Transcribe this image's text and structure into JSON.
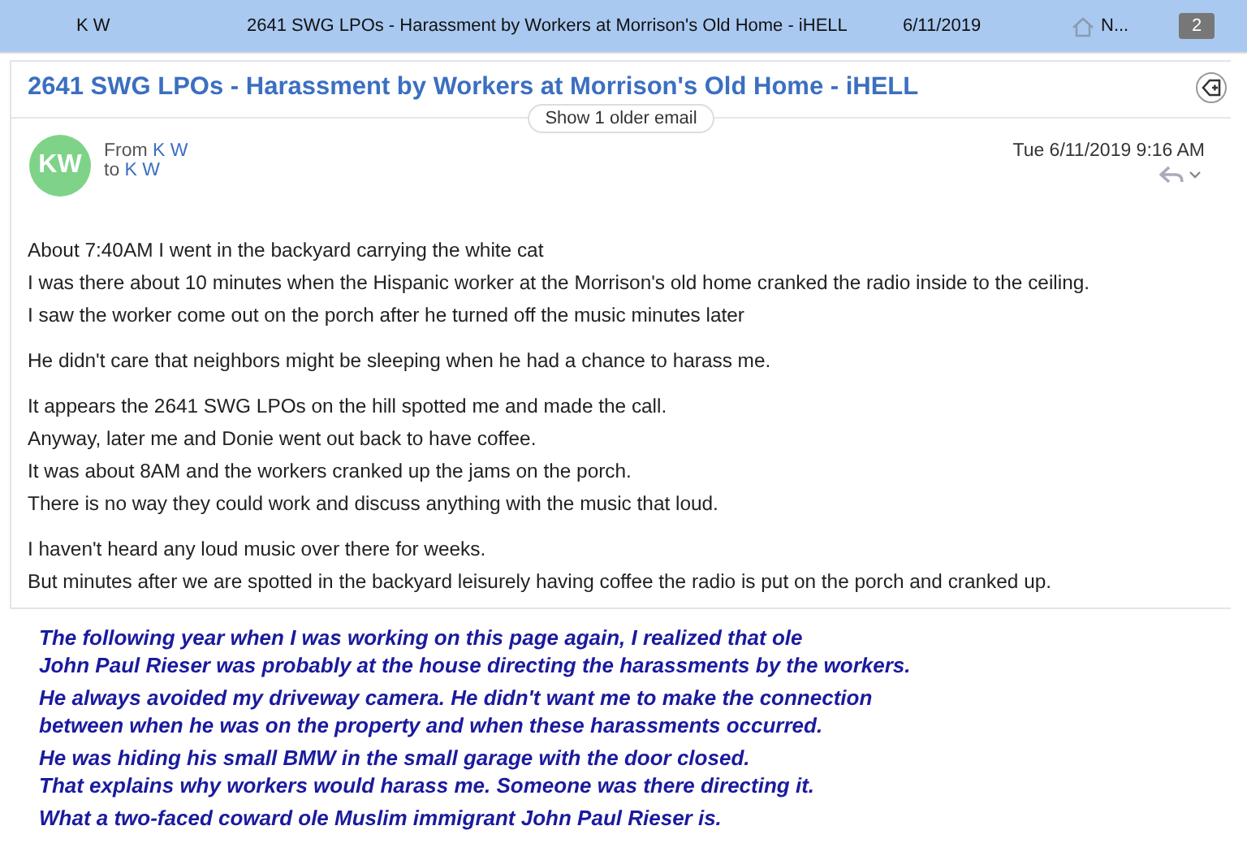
{
  "message_row": {
    "sender": "K W",
    "subject": "2641 SWG LPOs - Harassment by Workers at Morrison's Old Home - iHELL",
    "date": "6/11/2019",
    "folder": "N...",
    "count": "2",
    "selected": true
  },
  "email": {
    "subject": "2641 SWG LPOs - Harassment by Workers at Morrison's Old Home - iHELL",
    "older_button": "Show 1 older email",
    "avatar": "KW",
    "from_label": "From",
    "from": "K W",
    "to_label": "to",
    "to": "K W",
    "date": "Tue 6/11/2019 9:16 AM",
    "body": [
      [
        "About 7:40AM I went in the backyard carrying the white cat",
        "I was there about 10 minutes when the Hispanic worker at the Morrison's old home cranked the radio inside to the ceiling.",
        "I saw the worker come out on the porch after he turned off the music minutes later"
      ],
      [
        "He didn't care that neighbors might be sleeping when he had a chance to harass me."
      ],
      [
        "It appears the 2641 SWG LPOs on the hill spotted me and made the call.",
        "Anyway, later me and Donie went out back to have coffee.",
        "It was about 8AM and the workers cranked up the jams on the porch.",
        "There is no way they could work and discuss anything with the music that loud."
      ],
      [
        "I haven't heard any loud music over there for weeks.",
        "But minutes after we are spotted in the backyard leisurely having coffee the radio is put on the porch and cranked up."
      ]
    ]
  },
  "notes": [
    [
      "The following year when I was working on this page again, I realized that ole",
      "John Paul Rieser was probably at the house directing the harassments by the workers."
    ],
    [
      "He always avoided my driveway camera. He didn't want me to make the connection",
      "between when he was on the property and when these harassments occurred."
    ],
    [
      "He was hiding his small BMW in the small garage with the door closed.",
      "That explains why workers would harass me. Someone was there directing it."
    ],
    [
      "What a two-faced coward ole Muslim immigrant John Paul Rieser is."
    ]
  ]
}
